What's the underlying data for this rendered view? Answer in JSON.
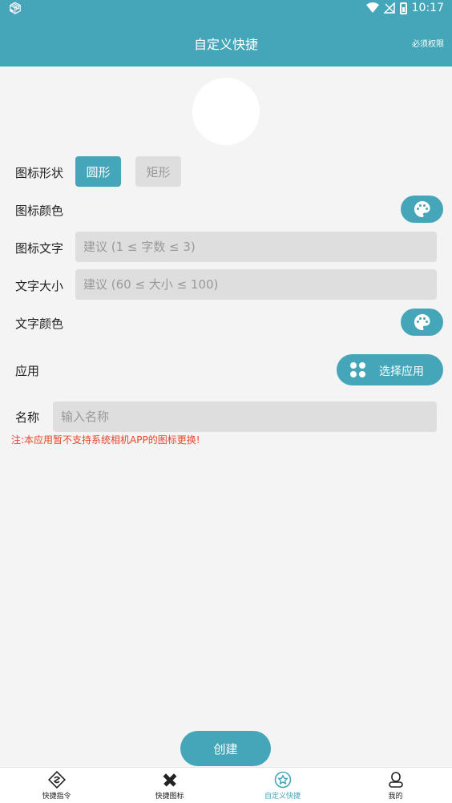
{
  "status_bar": {
    "time": "10:17"
  },
  "header": {
    "title": "自定义快捷",
    "permission_link": "必须权限"
  },
  "form": {
    "icon_shape": {
      "label": "图标形状",
      "options": [
        "圆形",
        "矩形"
      ],
      "selected": "圆形"
    },
    "icon_color": {
      "label": "图标颜色"
    },
    "icon_text": {
      "label": "图标文字",
      "placeholder": "建议 (1 ≤ 字数 ≤ 3)"
    },
    "text_size": {
      "label": "文字大小",
      "placeholder": "建议 (60 ≤ 大小 ≤ 100)"
    },
    "text_color": {
      "label": "文字颜色"
    },
    "app": {
      "label": "应用",
      "button": "选择应用"
    },
    "name": {
      "label": "名称",
      "placeholder": "输入名称"
    },
    "note": "注:本应用暂不支持系统相机APP的图标更换!"
  },
  "create_button": "创建",
  "bottom_nav": [
    {
      "label": "快捷指令",
      "icon": "shortcut-icon",
      "active": false
    },
    {
      "label": "快捷图标",
      "icon": "pencil-ruler-icon",
      "active": false
    },
    {
      "label": "自定义快捷",
      "icon": "star-circle-icon",
      "active": true
    },
    {
      "label": "我的",
      "icon": "user-icon",
      "active": false
    }
  ],
  "colors": {
    "primary": "#44a6b8",
    "warning": "#e8452c"
  }
}
